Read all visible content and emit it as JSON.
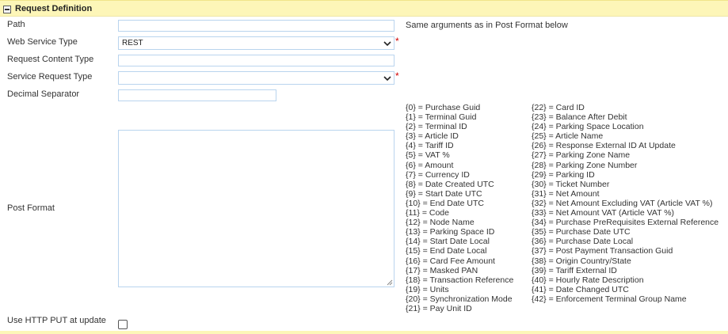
{
  "section": {
    "title": "Request Definition",
    "toggle_icon": "collapse-minus-icon"
  },
  "fields": {
    "path": {
      "label": "Path",
      "value": "",
      "hint": "Same arguments as in Post Format below"
    },
    "web_service_type": {
      "label": "Web Service Type",
      "selected": "REST",
      "required_mark": "*"
    },
    "request_content_type": {
      "label": "Request Content Type",
      "value": ""
    },
    "service_request_type": {
      "label": "Service Request Type",
      "selected": "",
      "required_mark": "*"
    },
    "decimal_separator": {
      "label": "Decimal Separator",
      "value": ""
    },
    "post_format": {
      "label": "Post Format",
      "value": ""
    },
    "use_http_put": {
      "label": "Use HTTP PUT at update",
      "checked": false
    }
  },
  "codes_left": [
    "{0} = Purchase Guid",
    "{1} = Terminal Guid",
    "{2} = Terminal ID",
    "{3} = Article ID",
    "{4} = Tariff ID",
    "{5} = VAT %",
    "{6} = Amount",
    "{7} = Currency ID",
    "{8} = Date Created UTC",
    "{9} = Start Date UTC",
    "{10} = End Date UTC",
    "{11} = Code",
    "{12} = Node Name",
    "{13} = Parking Space ID",
    "{14} = Start Date Local",
    "{15} = End Date Local",
    "{16} = Card Fee Amount",
    "{17} = Masked PAN",
    "{18} = Transaction Reference",
    "{19} = Units",
    "{20} = Synchronization Mode",
    "{21} = Pay Unit ID"
  ],
  "codes_right": [
    "{22} = Card ID",
    "{23} = Balance After Debit",
    "{24} = Parking Space Location",
    "{25} = Article Name",
    "{26} = Response External ID At Update",
    "{27} = Parking Zone Name",
    "{28} = Parking Zone Number",
    "{29} = Parking ID",
    "{30} = Ticket Number",
    "{31} = Net Amount",
    "{32} = Net Amount Excluding VAT (Article VAT %)",
    "{33} = Net Amount VAT (Article VAT %)",
    "{34} = Purchase PreRequisites External Reference",
    "{35} = Purchase Date UTC",
    "{36} = Purchase Date Local",
    "{37} = Post Payment Transaction Guid",
    "{38} = Origin Country/State",
    "{39} = Tariff External ID",
    "{40} = Hourly Rate Description",
    "{41} = Date Changed UTC",
    "{42} = Enforcement Terminal Group Name"
  ],
  "colors": {
    "header_bg": "#fdf6b8",
    "input_border": "#b9d4ee",
    "required": "#d00000"
  }
}
